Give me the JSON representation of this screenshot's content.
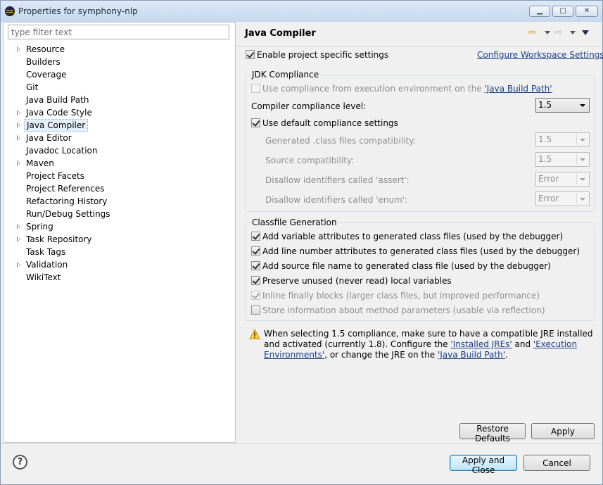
{
  "window": {
    "title": "Properties for symphony-nlp",
    "min_glyph": "▁",
    "max_glyph": "□",
    "close_glyph": "✕"
  },
  "filter": {
    "placeholder": "type filter text"
  },
  "tree": {
    "items": [
      {
        "label": "Resource",
        "expandable": true
      },
      {
        "label": "Builders",
        "expandable": false
      },
      {
        "label": "Coverage",
        "expandable": false
      },
      {
        "label": "Git",
        "expandable": false
      },
      {
        "label": "Java Build Path",
        "expandable": false
      },
      {
        "label": "Java Code Style",
        "expandable": true
      },
      {
        "label": "Java Compiler",
        "expandable": true,
        "selected": true
      },
      {
        "label": "Java Editor",
        "expandable": true
      },
      {
        "label": "Javadoc Location",
        "expandable": false
      },
      {
        "label": "Maven",
        "expandable": true
      },
      {
        "label": "Project Facets",
        "expandable": false
      },
      {
        "label": "Project References",
        "expandable": false
      },
      {
        "label": "Refactoring History",
        "expandable": false
      },
      {
        "label": "Run/Debug Settings",
        "expandable": false
      },
      {
        "label": "Spring",
        "expandable": true
      },
      {
        "label": "Task Repository",
        "expandable": true
      },
      {
        "label": "Task Tags",
        "expandable": false
      },
      {
        "label": "Validation",
        "expandable": true
      },
      {
        "label": "WikiText",
        "expandable": false
      }
    ]
  },
  "page": {
    "title": "Java Compiler",
    "nav_back_glyph": "⇦",
    "nav_forward_glyph": "⇨",
    "enable_specific": "Enable project specific settings",
    "configure_workspace": "Configure Workspace Settings...",
    "jdk": {
      "title": "JDK Compliance",
      "use_ee_prefix": "Use compliance from execution environment on the ",
      "use_ee_link": "'Java Build Path'",
      "level_label": "Compiler compliance level:",
      "level_value": "1.5",
      "use_default": "Use default compliance settings",
      "generated_label": "Generated .class files compatibility:",
      "generated_value": "1.5",
      "source_label": "Source compatibility:",
      "source_value": "1.5",
      "assert_label": "Disallow identifiers called 'assert':",
      "assert_value": "Error",
      "enum_label": "Disallow identifiers called 'enum':",
      "enum_value": "Error"
    },
    "classfile": {
      "title": "Classfile Generation",
      "opt1": "Add variable attributes to generated class files (used by the debugger)",
      "opt2": "Add line number attributes to generated class files (used by the debugger)",
      "opt3": "Add source file name to generated class file (used by the debugger)",
      "opt4": "Preserve unused (never read) local variables",
      "opt5": "Inline finally blocks (larger class files, but improved performance)",
      "opt6": "Store information about method parameters (usable via reflection)"
    },
    "warning": {
      "part1": "When selecting 1.5 compliance, make sure to have a compatible JRE installed and activated (currently 1.8). Configure the ",
      "link1": "'Installed JREs'",
      "part2": " and ",
      "link2": "'Execution Environments'",
      "part3": ", or change the JRE on the ",
      "link3": "'Java Build Path'",
      "part4": "."
    },
    "restore_defaults": "Restore Defaults",
    "apply": "Apply"
  },
  "footer": {
    "help_glyph": "?",
    "apply_close": "Apply and Close",
    "cancel": "Cancel"
  }
}
